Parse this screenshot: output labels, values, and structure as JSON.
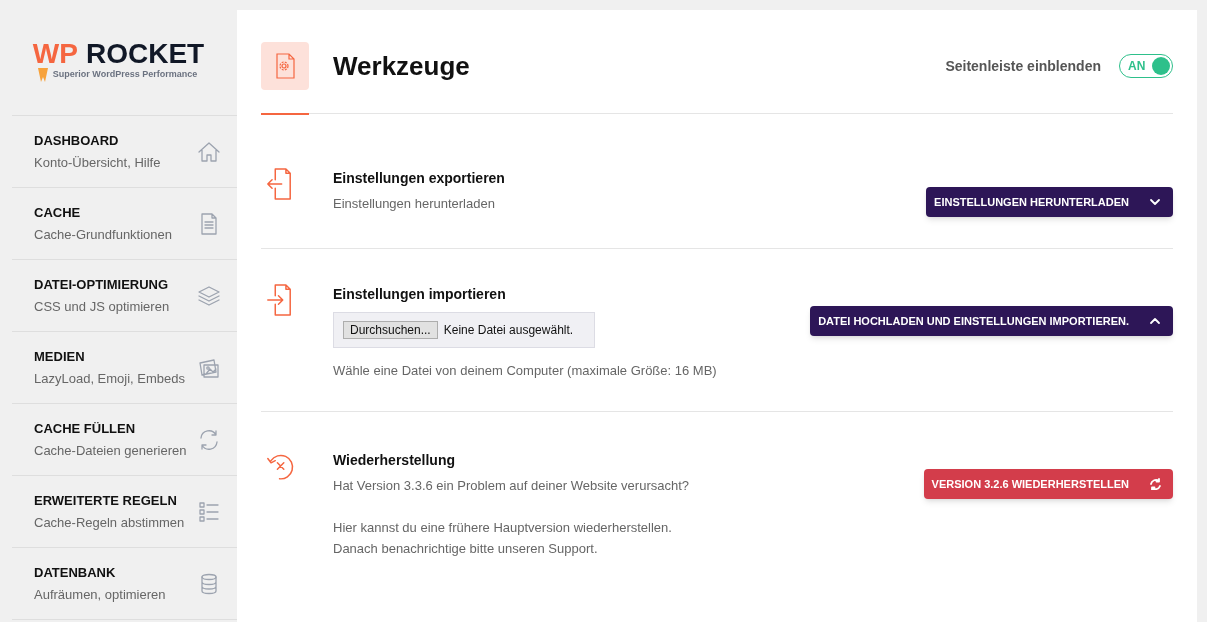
{
  "logo": {
    "brand_accent": "WP",
    "brand": "ROCKET",
    "tagline": "Superior WordPress Performance"
  },
  "sidebar": {
    "items": [
      {
        "kind": "home",
        "title": "DASHBOARD",
        "subtitle": "Konto-Übersicht, Hilfe",
        "selected": false
      },
      {
        "kind": "document",
        "title": "CACHE",
        "subtitle": "Cache-Grundfunktionen",
        "selected": false
      },
      {
        "kind": "layers",
        "title": "DATEI-OPTIMIERUNG",
        "subtitle": "CSS und JS optimieren",
        "selected": false
      },
      {
        "kind": "images",
        "title": "MEDIEN",
        "subtitle": "LazyLoad, Emoji, Embeds",
        "selected": false
      },
      {
        "kind": "refresh",
        "title": "CACHE FÜLLEN",
        "subtitle": "Cache-Dateien generieren",
        "selected": false
      },
      {
        "kind": "list",
        "title": "ERWEITERTE REGELN",
        "subtitle": "Cache-Regeln abstimmen",
        "selected": false
      },
      {
        "kind": "database",
        "title": "DATENBANK",
        "subtitle": "Aufräumen, optimieren",
        "selected": false
      }
    ]
  },
  "header": {
    "title": "Werkzeuge",
    "sidebar_toggle": {
      "label": "Seitenleiste einblenden",
      "state_text": "AN",
      "on": true
    }
  },
  "sections": [
    {
      "kind": "export",
      "title": "Einstellungen exportieren",
      "paragraphs": [
        [
          "Einstellungen herunterladen"
        ]
      ],
      "button": {
        "kind": "download",
        "label": "EINSTELLUNGEN HERUNTERLADEN"
      }
    },
    {
      "kind": "import",
      "title": "Einstellungen importieren",
      "file_input": {
        "button": "Durchsuchen...",
        "value": "Keine Datei ausgewählt."
      },
      "paragraphs": [
        [
          "Wähle eine Datei von deinem Computer (maximale Größe: 16 MB)"
        ]
      ],
      "button": {
        "kind": "upload",
        "label": "DATEI HOCHLADEN UND EINSTELLUNGEN IMPORTIEREN."
      }
    },
    {
      "kind": "restore",
      "title": "Wiederherstellung",
      "paragraphs": [
        [
          "Hat Version 3.3.6 ein Problem auf deiner Website verursacht?"
        ],
        [
          "Hier kannst du eine frühere Hauptversion wiederherstellen.",
          "Danach benachrichtige bitte unseren Support."
        ]
      ],
      "button": {
        "kind": "restore",
        "label": "VERSION 3.2.6 WIEDERHERSTELLEN"
      }
    }
  ]
}
